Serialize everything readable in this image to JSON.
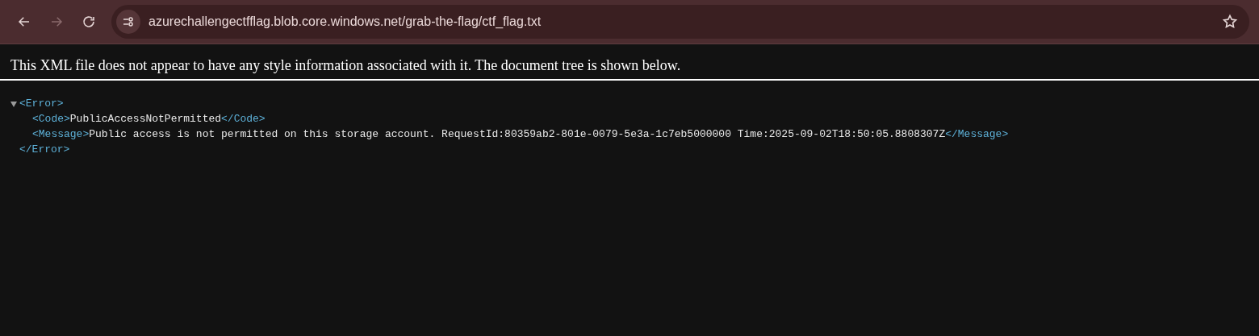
{
  "toolbar": {
    "back": {
      "disabled": false
    },
    "forward": {
      "disabled": true
    },
    "url": "azurechallengectfflag.blob.core.windows.net/grab-the-flag/ctf_flag.txt",
    "bookmarked": false
  },
  "notice": "This XML file does not appear to have any style information associated with it. The document tree is shown below.",
  "tree": {
    "open_tag": "<Error>",
    "close_tag": "</Error>",
    "expanded": true,
    "children": [
      {
        "open_tag": "<Code>",
        "text": "PublicAccessNotPermitted",
        "close_tag": "</Code>"
      },
      {
        "open_tag": "<Message>",
        "text": "Public access is not permitted on this storage account. RequestId:80359ab2-801e-0079-5e3a-1c7eb5000000 Time:2025-09-02T18:50:05.8808307Z",
        "close_tag": "</Message>"
      }
    ]
  }
}
